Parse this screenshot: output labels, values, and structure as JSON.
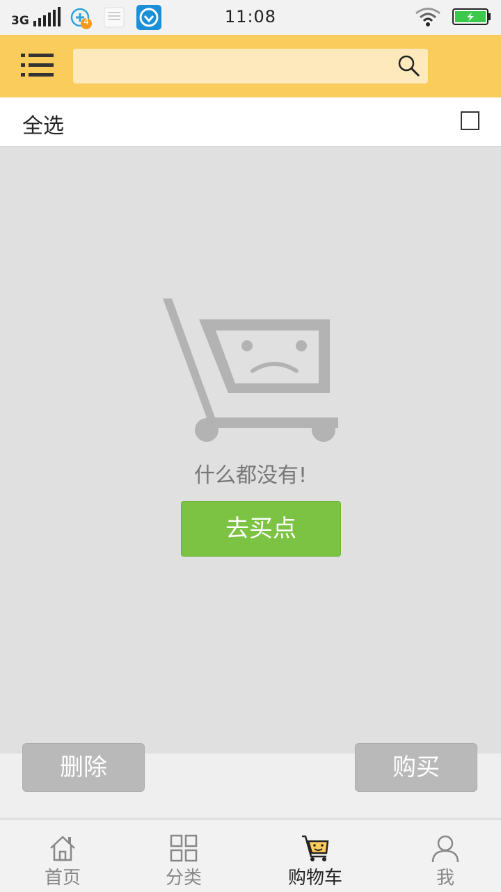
{
  "status_bar": {
    "network": "3G",
    "notification_badge": "4",
    "time": "11:08"
  },
  "search": {
    "value": "",
    "placeholder": ""
  },
  "select_all": {
    "label": "全选",
    "checked": false
  },
  "empty_state": {
    "message": "什么都没有!",
    "action_label": "去买点"
  },
  "actions": {
    "delete_label": "删除",
    "buy_label": "购买"
  },
  "tabs": [
    {
      "label": "首页",
      "icon": "home-icon",
      "active": false
    },
    {
      "label": "分类",
      "icon": "grid-icon",
      "active": false
    },
    {
      "label": "购物车",
      "icon": "cart-icon",
      "active": true
    },
    {
      "label": "我",
      "icon": "person-icon",
      "active": false
    }
  ],
  "colors": {
    "header_bg": "#f9cc5c",
    "search_bg": "#fde9bb",
    "primary_green": "#7cc343",
    "disabled_grey": "#b9b9b9",
    "battery_green": "#3ac94a"
  }
}
